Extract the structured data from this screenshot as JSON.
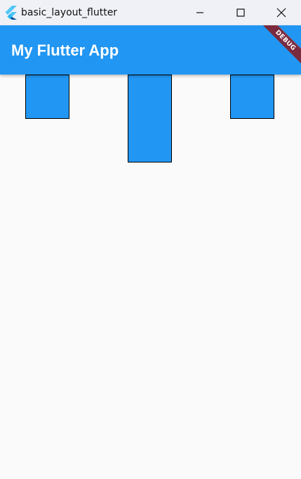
{
  "window": {
    "title": "basic_layout_flutter",
    "controls": {
      "minimize_icon": "minimize-icon",
      "maximize_icon": "maximize-icon",
      "close_icon": "close-icon"
    }
  },
  "appbar": {
    "title": "My Flutter App",
    "color": "#2196f3"
  },
  "debug_banner": {
    "label": "DEBUG",
    "color": "#7a2a3f"
  },
  "content": {
    "boxes": [
      {
        "name": "box-left",
        "color": "#2196f3"
      },
      {
        "name": "box-center",
        "color": "#2196f3"
      },
      {
        "name": "box-right",
        "color": "#2196f3"
      }
    ]
  }
}
